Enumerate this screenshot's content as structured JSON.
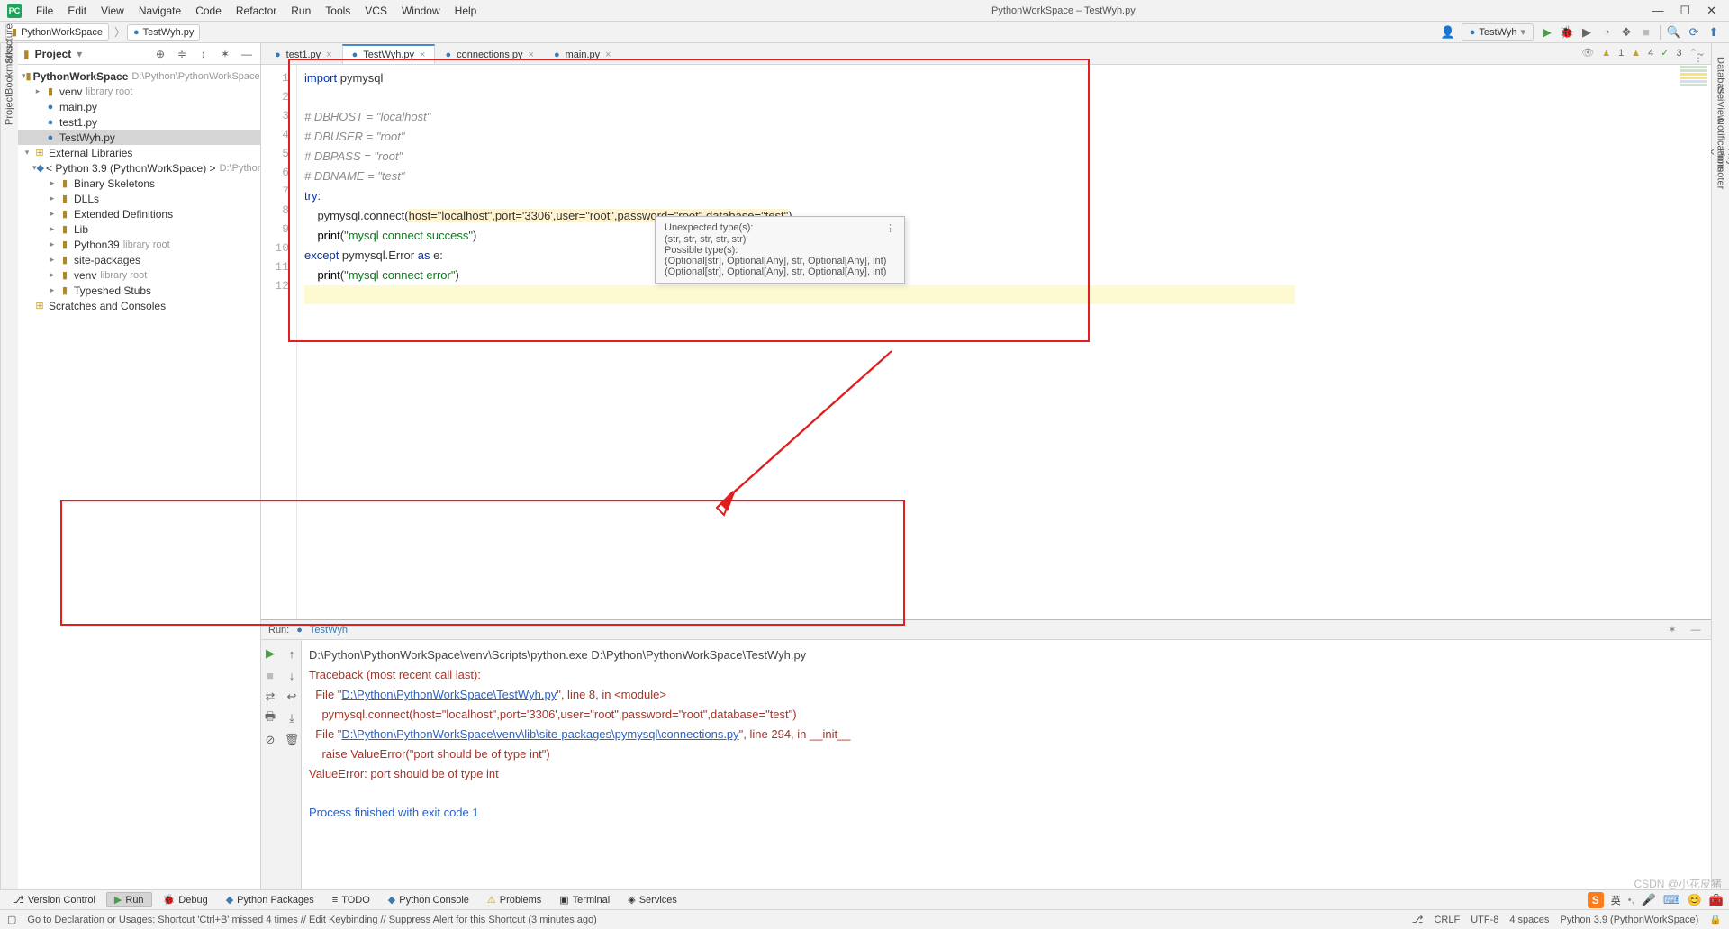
{
  "menubar": {
    "items": [
      "File",
      "Edit",
      "View",
      "Navigate",
      "Code",
      "Refactor",
      "Run",
      "Tools",
      "VCS",
      "Window",
      "Help"
    ],
    "title": "PythonWorkSpace – TestWyh.py"
  },
  "breadcrumbs": {
    "project": "PythonWorkSpace",
    "file": "TestWyh.py"
  },
  "runConfig": "TestWyh",
  "projectPanel": {
    "title": "Project",
    "root": {
      "name": "PythonWorkSpace",
      "path": "D:\\Python\\PythonWorkSpace"
    },
    "venv": {
      "name": "venv",
      "hint": "library root"
    },
    "files": [
      "main.py",
      "test1.py",
      "TestWyh.py"
    ],
    "ext": {
      "title": "External Libraries",
      "sdk": {
        "name": "< Python 3.9 (PythonWorkSpace) >",
        "path": "D:\\Python\\Py"
      },
      "children": [
        {
          "name": "Binary Skeletons",
          "hint": ""
        },
        {
          "name": "DLLs",
          "hint": ""
        },
        {
          "name": "Extended Definitions",
          "hint": ""
        },
        {
          "name": "Lib",
          "hint": ""
        },
        {
          "name": "Python39",
          "hint": "library root"
        },
        {
          "name": "site-packages",
          "hint": ""
        },
        {
          "name": "venv",
          "hint": "library root"
        },
        {
          "name": "Typeshed Stubs",
          "hint": ""
        }
      ]
    },
    "scratches": "Scratches and Consoles"
  },
  "tabs": [
    {
      "name": "test1.py",
      "active": false
    },
    {
      "name": "TestWyh.py",
      "active": true
    },
    {
      "name": "connections.py",
      "active": false
    },
    {
      "name": "main.py",
      "active": false
    }
  ],
  "code": {
    "lines": 12,
    "l1": {
      "kw": "import",
      "rest": " pymysql"
    },
    "l3": "# DBHOST = \"localhost\"",
    "l4": "# DBUSER = \"root\"",
    "l5": "# DBPASS = \"root\"",
    "l6": "# DBNAME = \"test\"",
    "l7": {
      "kw": "try",
      "rest": ":"
    },
    "l8": {
      "pre": "    pymysql.connect(",
      "args": "host=\"localhost\",port='3306',user=\"root\",password=\"root\",database=\"test\"",
      "post": ")"
    },
    "l9": {
      "pre": "    ",
      "fn": "print",
      "open": "(",
      "str": "\"mysql connect success\"",
      "close": ")"
    },
    "l10": {
      "kw1": "except",
      "mid": " pymysql.Error ",
      "kw2": "as",
      "rest": " e:"
    },
    "l11": {
      "pre": "    ",
      "fn": "print",
      "open": "(",
      "str": "\"mysql connect error\"",
      "close": ")"
    }
  },
  "tooltip": {
    "t1": "Unexpected type(s):",
    "t2": "(str, str, str, str, str)",
    "t3": "Possible type(s):",
    "t4": "(Optional[str], Optional[Any], str, Optional[Any], int)",
    "t5": "(Optional[str], Optional[Any], str, Optional[Any], int)"
  },
  "inspections": {
    "warn": "1",
    "weak": "4",
    "ok": "3"
  },
  "runHeader": {
    "label": "Run:",
    "name": "TestWyh"
  },
  "console": {
    "cmd": "D:\\Python\\PythonWorkSpace\\venv\\Scripts\\python.exe D:\\Python\\PythonWorkSpace\\TestWyh.py",
    "tb": "Traceback (most recent call last):",
    "f1a": "  File \"",
    "f1link": "D:\\Python\\PythonWorkSpace\\TestWyh.py",
    "f1b": "\", line 8, in <module>",
    "l2": "    pymysql.connect(host=\"localhost\",port='3306',user=\"root\",password=\"root\",database=\"test\")",
    "f2a": "  File \"",
    "f2link": "D:\\Python\\PythonWorkSpace\\venv\\lib\\site-packages\\pymysql\\connections.py",
    "f2b": "\", line 294, in __init__",
    "l4": "    raise ValueError(\"port should be of type int\")",
    "l5": "ValueError: port should be of type int",
    "exit": "Process finished with exit code 1"
  },
  "bottomTools": [
    "Version Control",
    "Run",
    "Debug",
    "Python Packages",
    "TODO",
    "Python Console",
    "Problems",
    "Terminal",
    "Services"
  ],
  "sogouLabel": "英 ",
  "status": {
    "msg": "Go to Declaration or Usages: Shortcut 'Ctrl+B' missed 4 times // Edit Keybinding // Suppress Alert for this Shortcut (3 minutes ago)",
    "crlf": "CRLF",
    "enc": "UTF-8",
    "indent": "4 spaces",
    "sdk": "Python 3.9 (PythonWorkSpace)"
  },
  "leftTabs": [
    "Project",
    "Bookmarks",
    "Structure"
  ],
  "rightTabs": [
    "Database",
    "SciView",
    "Notifications",
    "Key Promoter X"
  ],
  "watermark": "CSDN @小花皮猪"
}
